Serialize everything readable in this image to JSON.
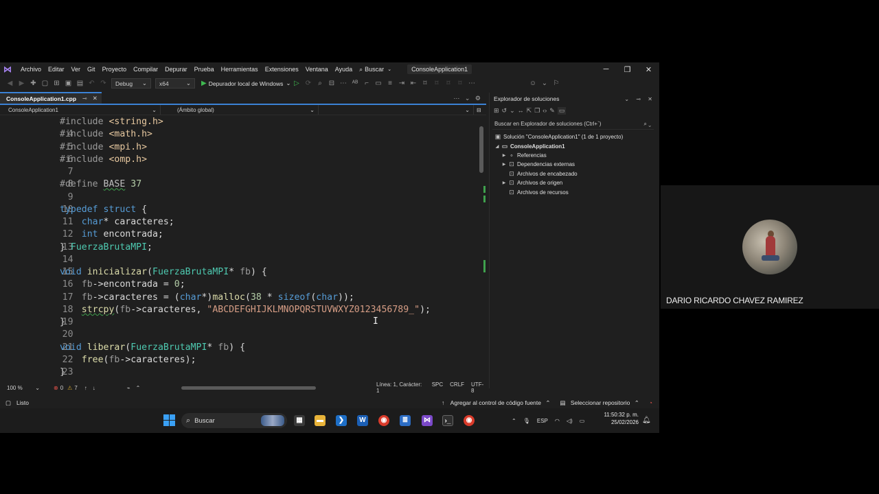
{
  "menubar": {
    "items": [
      "Archivo",
      "Editar",
      "Ver",
      "Git",
      "Proyecto",
      "Compilar",
      "Depurar",
      "Prueba",
      "Herramientas",
      "Extensiones",
      "Ventana",
      "Ayuda"
    ],
    "search_label": "Buscar",
    "solution_name": "ConsoleApplication1"
  },
  "toolbar": {
    "config": "Debug",
    "platform": "x64",
    "debugger": "Depurador local de Windows"
  },
  "editor": {
    "tab_title": "ConsoleApplication1.cpp",
    "nav_project": "ConsoleApplication1",
    "nav_scope": "(Ámbito global)",
    "nav_member": ""
  },
  "code": {
    "line_numbers": [
      "4",
      "5",
      "6",
      "7",
      "8",
      "9",
      "10",
      "11",
      "12",
      "13",
      "14",
      "15",
      "16",
      "17",
      "18",
      "19",
      "20",
      "21",
      "22",
      "23",
      "24"
    ],
    "l4": [
      "#include ",
      "<string.h>"
    ],
    "l5": [
      "#include ",
      "<math.h>"
    ],
    "l6": [
      "#include ",
      "<mpi.h>"
    ],
    "l7": [
      "#include ",
      "<omp.h>"
    ],
    "l9": [
      "#define ",
      "BASE",
      " ",
      "37"
    ],
    "l11": [
      "typedef",
      " ",
      "struct",
      " {"
    ],
    "l12": [
      "    ",
      "char",
      "* caracteres;"
    ],
    "l13": [
      "    ",
      "int",
      " encontrada;"
    ],
    "l14": [
      "} ",
      "FuerzaBrutaMPI",
      ";"
    ],
    "l16": [
      "void",
      " ",
      "inicializar",
      "(",
      "FuerzaBrutaMPI",
      "* ",
      "fb",
      ") {"
    ],
    "l17": [
      "    ",
      "fb",
      "->encontrada = ",
      "0",
      ";"
    ],
    "l18": [
      "    ",
      "fb",
      "->caracteres = (",
      "char",
      "*)",
      "malloc",
      "(",
      "38",
      " * ",
      "sizeof",
      "(",
      "char",
      "));"
    ],
    "l19": [
      "    ",
      "strcpy",
      "(",
      "fb",
      "->caracteres, ",
      "\"ABCDEFGHIJKLMNOPQRSTUVWXYZ0123456789_\"",
      ");"
    ],
    "l20": [
      "}"
    ],
    "l22": [
      "void",
      " ",
      "liberar",
      "(",
      "FuerzaBrutaMPI",
      "* ",
      "fb",
      ") {"
    ],
    "l23": [
      "    ",
      "free",
      "(",
      "fb",
      "->caracteres);"
    ],
    "l24": [
      "}"
    ]
  },
  "editor_status": {
    "zoom": "100 %",
    "errors": "0",
    "warnings": "7",
    "position": "Línea: 1, Carácter: 1",
    "whitespace": "SPC",
    "line_ending": "CRLF",
    "encoding": "UTF-8"
  },
  "solution_explorer": {
    "title": "Explorador de soluciones",
    "search_placeholder": "Buscar en Explorador de soluciones (Ctrl+`)",
    "solution": "Solución \"ConsoleApplication1\" (1 de 1 proyecto)",
    "project": "ConsoleApplication1",
    "nodes": [
      "Referencias",
      "Dependencias externas",
      "Archivos de encabezado",
      "Archivos de origen",
      "Archivos de recursos"
    ]
  },
  "ide_status": {
    "ready": "Listo",
    "source_control": "Agregar al control de código fuente",
    "repo": "Seleccionar repositorio"
  },
  "taskbar": {
    "search": "Buscar",
    "lang": "ESP",
    "time": "11:50:32 p. m.",
    "date": "25/02/2026"
  },
  "webcam": {
    "participant_name": "DARIO RICARDO CHAVEZ RAMIREZ"
  },
  "colors": {
    "accent": "#3b82d6",
    "keyword": "#569cd6",
    "type": "#4ec9b0",
    "function": "#dcdcaa",
    "string": "#d69d85",
    "number": "#b5cea8"
  }
}
